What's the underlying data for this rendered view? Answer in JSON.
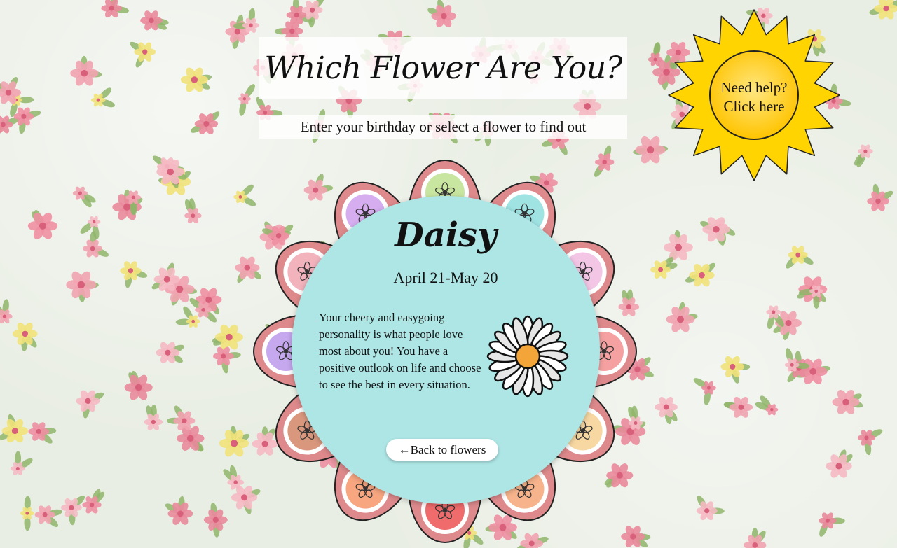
{
  "header": {
    "title": "Which Flower Are You?",
    "subtitle": "Enter your birthday or select a flower to find out"
  },
  "help": {
    "line1": "Need help?",
    "line2": "Click here"
  },
  "selected": {
    "name": "Daisy",
    "dates": "April 21-May 20",
    "description": "Your cheery and easygoing personality is what people love most about you! You have a positive outlook on life and choose to see the best in every situation.",
    "icon": "daisy-icon"
  },
  "back_button": {
    "label": "←Back to flowers"
  },
  "petals": [
    {
      "icon": "snowdrop-icon",
      "color": "#c9e6a0"
    },
    {
      "icon": "violet-icon",
      "color": "#9fe3e3"
    },
    {
      "icon": "lily-icon",
      "color": "#f3c6e6"
    },
    {
      "icon": "rose-icon",
      "color": "#f6a1a1"
    },
    {
      "icon": "sunflower-icon",
      "color": "#f7d8a2"
    },
    {
      "icon": "marigold-icon",
      "color": "#f7b48c"
    },
    {
      "icon": "poppy-icon",
      "color": "#f06b6b"
    },
    {
      "icon": "aster-icon",
      "color": "#f7a680"
    },
    {
      "icon": "chrysanthemum-icon",
      "color": "#d9987e"
    },
    {
      "icon": "iris-icon",
      "color": "#c6a8ef"
    },
    {
      "icon": "carnation-icon",
      "color": "#f2b3bd"
    },
    {
      "icon": "orchid-icon",
      "color": "#d6aef0"
    }
  ],
  "colors": {
    "petal": "#de8a8c",
    "card": "#aee6e6",
    "sun": "#ffd400",
    "sun_outline": "#b8860b"
  }
}
